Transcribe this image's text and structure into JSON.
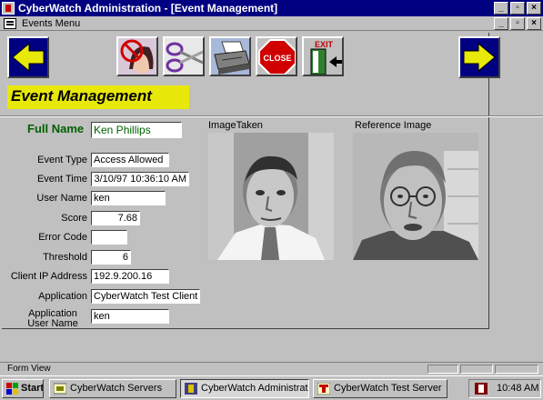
{
  "window": {
    "title": "CyberWatch Administration - [Event Management]",
    "menu_label": "Events Menu"
  },
  "toolbar": {
    "close_label": "CLOSE",
    "exit_label": "EXIT"
  },
  "header": {
    "title": "Event Management"
  },
  "form": {
    "full_name_label": "Full Name",
    "full_name": "Ken Phillips",
    "fields": [
      {
        "label": "Event Type",
        "value": "Access Allowed"
      },
      {
        "label": "Event Time",
        "value": "3/10/97 10:36:10 AM"
      },
      {
        "label": "User Name",
        "value": "ken"
      },
      {
        "label": "Score",
        "value": "7.68"
      },
      {
        "label": "Error Code",
        "value": ""
      },
      {
        "label": "Threshold",
        "value": "6"
      },
      {
        "label": "Client IP Address",
        "value": "192.9.200.16"
      },
      {
        "label": "Application",
        "value": "CyberWatch Test Client App"
      },
      {
        "label": "Application User Name",
        "value": "ken"
      }
    ],
    "image_taken_label": "ImageTaken",
    "reference_image_label": "Reference Image"
  },
  "status_bar": {
    "text": "Form View"
  },
  "taskbar": {
    "start_label": "Start",
    "items": [
      {
        "label": "CyberWatch Servers"
      },
      {
        "label": "CyberWatch Administration..."
      },
      {
        "label": "CyberWatch Test Server"
      }
    ],
    "clock": "10:48 AM"
  },
  "colors": {
    "title_bar": "#000080",
    "banner": "#e8e80a",
    "full_name": "#006000",
    "arrow": "#e8e80a",
    "stop_sign": "#d00000"
  }
}
